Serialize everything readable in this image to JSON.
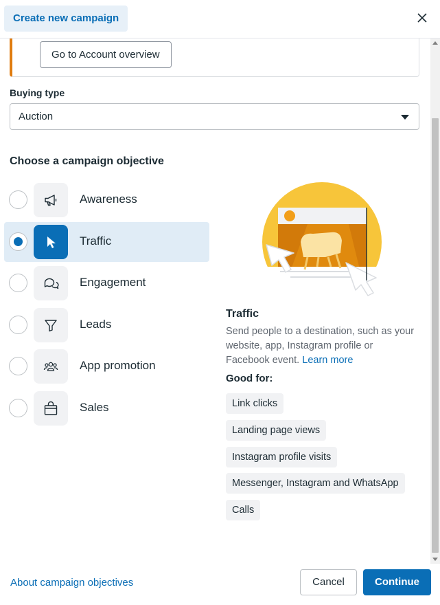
{
  "header": {
    "title": "Create new campaign",
    "close_icon": "close-icon"
  },
  "account_card": {
    "button_label": "Go to Account overview",
    "accent_color": "#e07c10"
  },
  "buying_type": {
    "label": "Buying type",
    "value": "Auction",
    "caret_icon": "caret-down-icon"
  },
  "objectives": {
    "heading": "Choose a campaign objective",
    "items": [
      {
        "label": "Awareness",
        "icon": "megaphone-icon",
        "selected": false
      },
      {
        "label": "Traffic",
        "icon": "cursor-icon",
        "selected": true
      },
      {
        "label": "Engagement",
        "icon": "chat-bubbles-icon",
        "selected": false
      },
      {
        "label": "Leads",
        "icon": "funnel-icon",
        "selected": false
      },
      {
        "label": "App promotion",
        "icon": "people-icon",
        "selected": false
      },
      {
        "label": "Sales",
        "icon": "shopping-bag-icon",
        "selected": false
      }
    ]
  },
  "detail": {
    "title": "Traffic",
    "description": "Send people to a destination, such as your website, app, Instagram profile or Facebook event.",
    "learn_more": "Learn more",
    "good_for_label": "Good for:",
    "good_for": [
      "Link clicks",
      "Landing page views",
      "Instagram profile visits",
      "Messenger, Instagram and WhatsApp",
      "Calls"
    ]
  },
  "footer": {
    "about_link": "About campaign objectives",
    "cancel_label": "Cancel",
    "continue_label": "Continue"
  },
  "colors": {
    "accent": "#0a6eb6",
    "selected_row": "#e0ecf6",
    "tag_background": "#f1f2f4",
    "illustration_yellow": "#f7c53a",
    "illustration_orange": "#e08a0e"
  }
}
